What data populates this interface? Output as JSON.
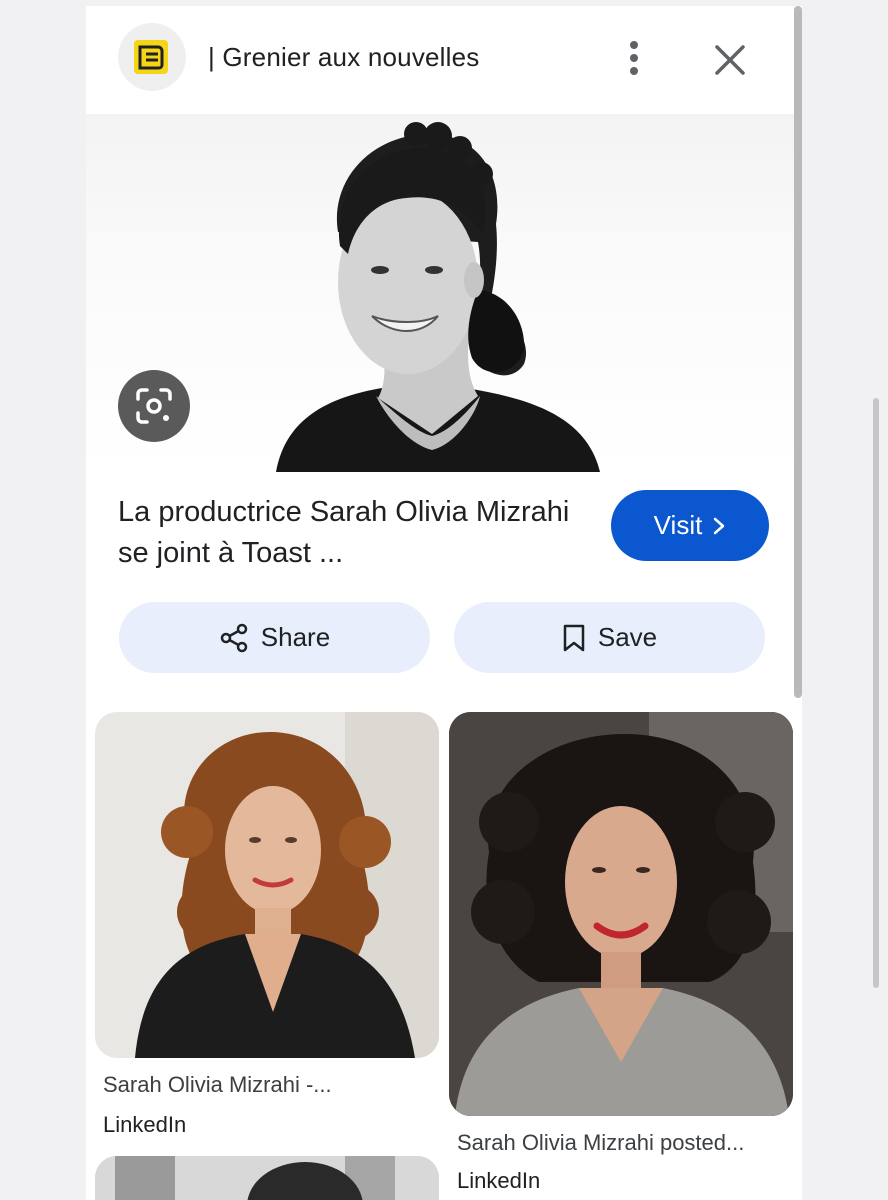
{
  "header": {
    "site_name": "| Grenier aux nouvelles",
    "favicon_color": "#f4d616"
  },
  "hero": {
    "caption": "La productrice Sarah Olivia Mizrahi se joint à Toast ...",
    "visit_label": "Visit",
    "visit_color": "#0b57d0"
  },
  "actions": {
    "share_label": "Share",
    "save_label": "Save"
  },
  "related": [
    {
      "title": "Sarah Olivia Mizrahi -...",
      "source": "LinkedIn"
    },
    {
      "title": "Sarah Olivia Mizrahi posted...",
      "source": "LinkedIn"
    }
  ]
}
